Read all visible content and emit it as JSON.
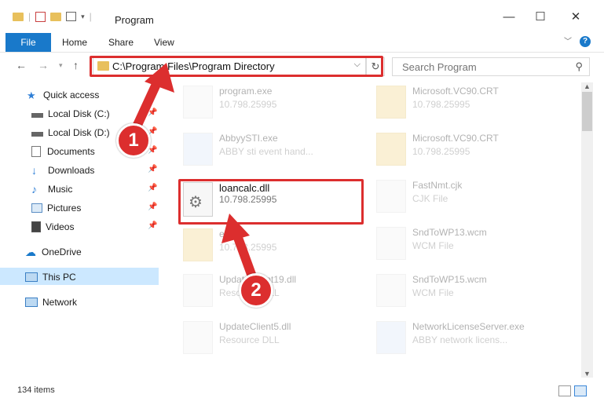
{
  "window": {
    "title": "Program",
    "minimize": "—",
    "maximize": "☐",
    "close": "✕"
  },
  "ribbon": {
    "file": "File",
    "home": "Home",
    "share": "Share",
    "view": "View"
  },
  "address": {
    "path": "C:\\Program Files\\Program Directory"
  },
  "search": {
    "placeholder": "Search Program"
  },
  "sidebar": {
    "items": [
      {
        "label": "Quick access"
      },
      {
        "label": "Local Disk (C:)"
      },
      {
        "label": "Local Disk (D:)"
      },
      {
        "label": "Documents"
      },
      {
        "label": "Downloads"
      },
      {
        "label": "Music"
      },
      {
        "label": "Pictures"
      },
      {
        "label": "Videos"
      },
      {
        "label": "OneDrive"
      },
      {
        "label": "This PC"
      },
      {
        "label": "Network"
      }
    ]
  },
  "files": {
    "left": [
      {
        "name": "program.exe",
        "sub": "10.798.25995"
      },
      {
        "name": "AbbyySTI.exe",
        "sub": "ABBY sti event hand..."
      },
      {
        "name": "loancalc.dll",
        "sub": "10.798.25995"
      },
      {
        "name": "el...",
        "sub": "10.798.25995"
      },
      {
        "name": "UpdateClient19.dll",
        "sub": "Resource DLL"
      },
      {
        "name": "UpdateClient5.dll",
        "sub": "Resource DLL"
      }
    ],
    "right": [
      {
        "name": "Microsoft.VC90.CRT",
        "sub": "10.798.25995"
      },
      {
        "name": "Microsoft.VC90.CRT",
        "sub": "10.798.25995"
      },
      {
        "name": "FastNmt.cjk",
        "sub": "CJK File"
      },
      {
        "name": "SndToWP13.wcm",
        "sub": "WCM File"
      },
      {
        "name": "SndToWP15.wcm",
        "sub": "WCM File"
      },
      {
        "name": "NetworkLicenseServer.exe",
        "sub": "ABBY network licens..."
      }
    ]
  },
  "callouts": {
    "one": "1",
    "two": "2"
  },
  "status": {
    "count": "134 items"
  },
  "colors": {
    "accent": "#1979ca",
    "callout": "#dc2e2e",
    "selection": "#cce8ff"
  }
}
